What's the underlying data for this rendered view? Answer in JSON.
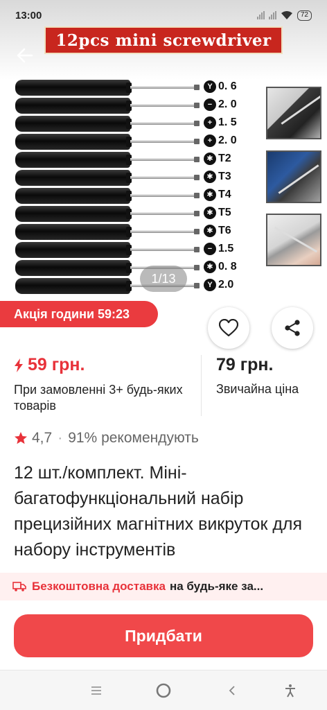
{
  "status_bar": {
    "time": "13:00",
    "battery": "72"
  },
  "banner": {
    "text": "12pcs mini screwdriver"
  },
  "tools": [
    {
      "icon": "Y",
      "label": "0. 6"
    },
    {
      "icon": "−",
      "label": "2. 0"
    },
    {
      "icon": "+",
      "label": "1. 5"
    },
    {
      "icon": "+",
      "label": "2. 0"
    },
    {
      "icon": "✱",
      "label": "T2"
    },
    {
      "icon": "✱",
      "label": "T3"
    },
    {
      "icon": "✱",
      "label": "T4"
    },
    {
      "icon": "✱",
      "label": "T5"
    },
    {
      "icon": "✱",
      "label": "T6"
    },
    {
      "icon": "−",
      "label": "1.5"
    },
    {
      "icon": "✱",
      "label": "0. 8"
    },
    {
      "icon": "Y",
      "label": "2.0"
    }
  ],
  "gallery": {
    "pager": "1/13"
  },
  "promo": {
    "text": "Акція години 59:23"
  },
  "price": {
    "sale": "59 грн.",
    "sale_note": "При замовленні 3+ будь-яких товарів",
    "regular": "79 грн.",
    "regular_note": "Звичайна ціна"
  },
  "rating": {
    "value": "4,7",
    "separator": "·",
    "recommend": "91% рекомендують"
  },
  "product": {
    "title": "12 шт./комплект. Міні-багатофункціональний набір прецизійних магнітних викруток для набору інструментів"
  },
  "shipping": {
    "free": "Безкоштовна доставка",
    "rest": "на будь-яке за..."
  },
  "buy_button": {
    "label": "Придбати"
  },
  "colors": {
    "accent": "#f0484a",
    "price_red": "#e8323a",
    "promo_red": "#ea3b3f",
    "banner_red": "#c8261e"
  }
}
